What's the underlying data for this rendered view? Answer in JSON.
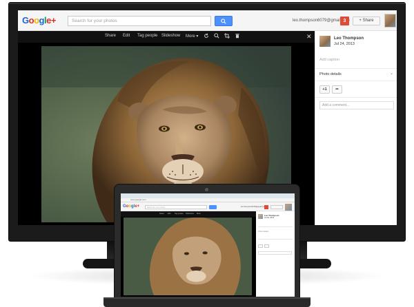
{
  "app": {
    "logo_text": "Google+",
    "logo_colors": [
      "#1a66d9",
      "#d93025",
      "#f4b400",
      "#0f9d58"
    ]
  },
  "header": {
    "search_placeholder": "Search for your photos",
    "search_button_icon": "search-icon",
    "account_email": "leo.thompson6079@gmail.com",
    "notification_count": "3",
    "share_label": "+ Share"
  },
  "toolbar": {
    "items": [
      "Share",
      "Edit",
      "Tag people",
      "Slideshow",
      "More"
    ],
    "more_chevron": "▾",
    "icons": [
      "rotate-icon",
      "zoom-icon",
      "crop-icon",
      "delete-icon"
    ],
    "close_icon": "close-icon"
  },
  "photo": {
    "subject": "lion",
    "icon_name": "lion-photo"
  },
  "side_panel": {
    "author_name": "Leo Thompson",
    "date": "Jul 24, 2013",
    "add_caption": "Add caption",
    "photo_details": "Photo details",
    "plus_one": "+1",
    "share_icon": "share-arrow-icon",
    "comment_placeholder": "Add a comment..."
  },
  "laptop": {
    "url": "www.google.com",
    "author_name": "Leo Thompson",
    "date": "Jul 24, 2013",
    "toolbar_items": [
      "Share",
      "Edit",
      "Tag people",
      "Slideshow",
      "More"
    ],
    "side_lines": [
      "Photo details",
      "Add a comment..."
    ]
  },
  "colors": {
    "accent_blue": "#4d90fe",
    "notification_red": "#dd4b39",
    "bezel": "#1b1b1b"
  }
}
